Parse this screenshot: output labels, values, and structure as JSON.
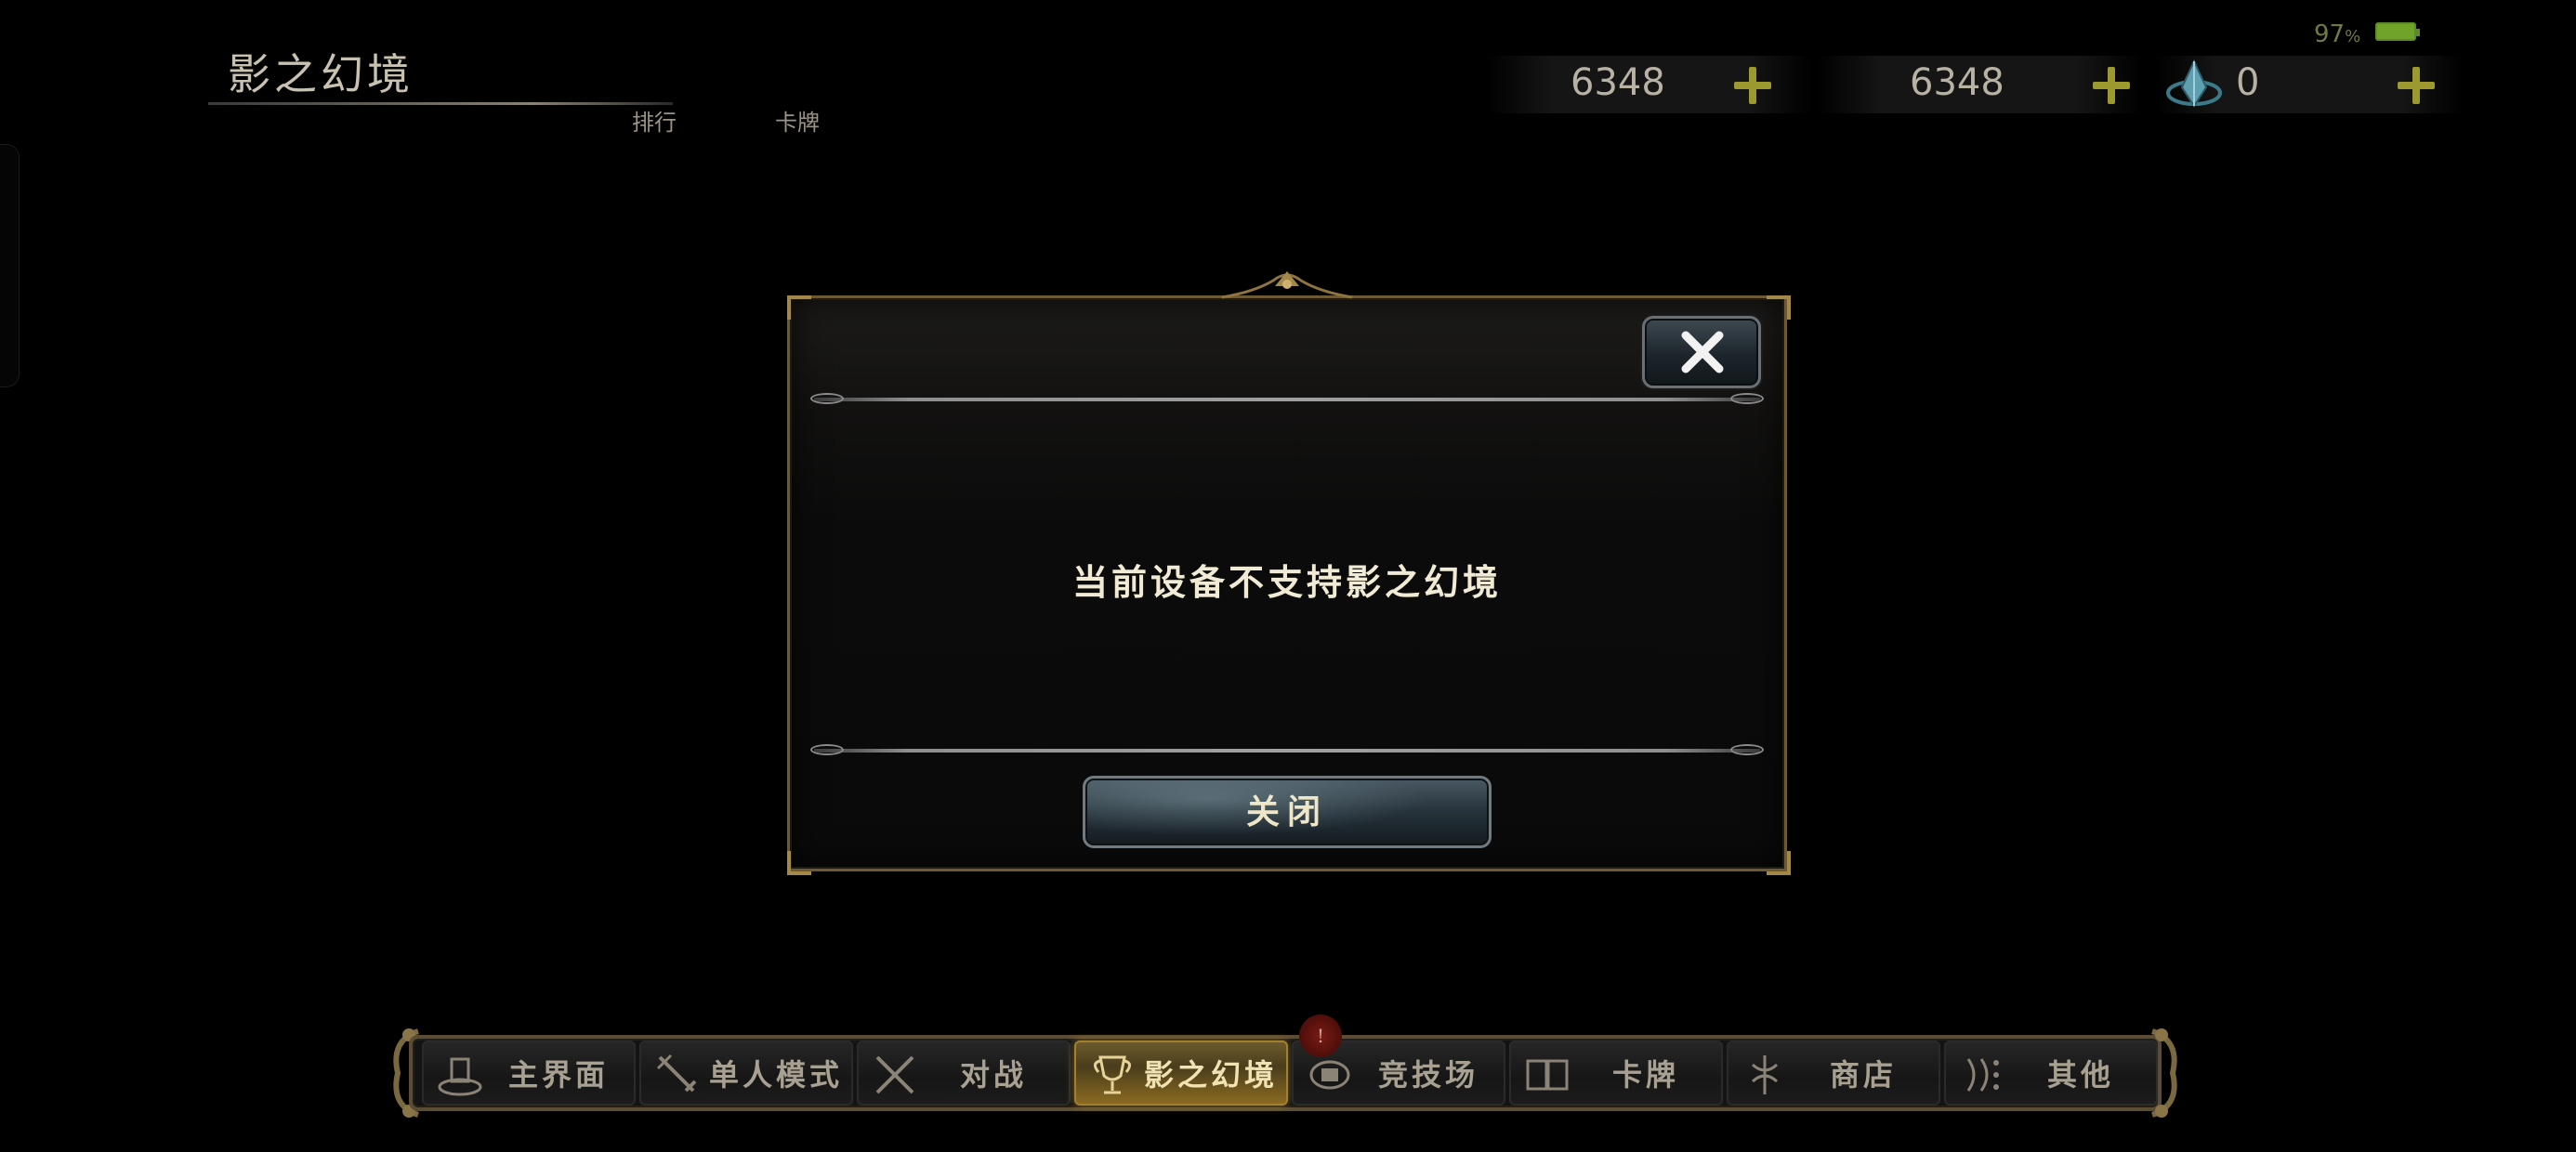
{
  "header": {
    "title": "影之幻境",
    "subnav": [
      "排行",
      "卡牌"
    ]
  },
  "currencies": [
    {
      "icon": "coin",
      "value": "6348"
    },
    {
      "icon": "crystal",
      "value": "6348"
    },
    {
      "icon": "gem-icon",
      "value": "0"
    }
  ],
  "status": {
    "battery": "97",
    "battery_unit": "%"
  },
  "dialog": {
    "message": "当前设备不支持影之幻境",
    "close_button": "关闭"
  },
  "nav": {
    "items": [
      {
        "label": "主界面",
        "icon": "home-icon"
      },
      {
        "label": "单人模式",
        "icon": "sword-icon"
      },
      {
        "label": "对战",
        "icon": "crossed-swords-icon"
      },
      {
        "label": "影之幻境",
        "icon": "trophy-icon",
        "active": true
      },
      {
        "label": "竞技场",
        "icon": "arena-icon"
      },
      {
        "label": "卡牌",
        "icon": "cards-icon"
      },
      {
        "label": "商店",
        "icon": "shop-icon"
      },
      {
        "label": "其他",
        "icon": "misc-icon"
      }
    ],
    "badge": "!"
  },
  "colors": {
    "accent_gold": "#a48848",
    "plus_green": "#9c9a2e",
    "dialog_border": "#6e5a32"
  }
}
